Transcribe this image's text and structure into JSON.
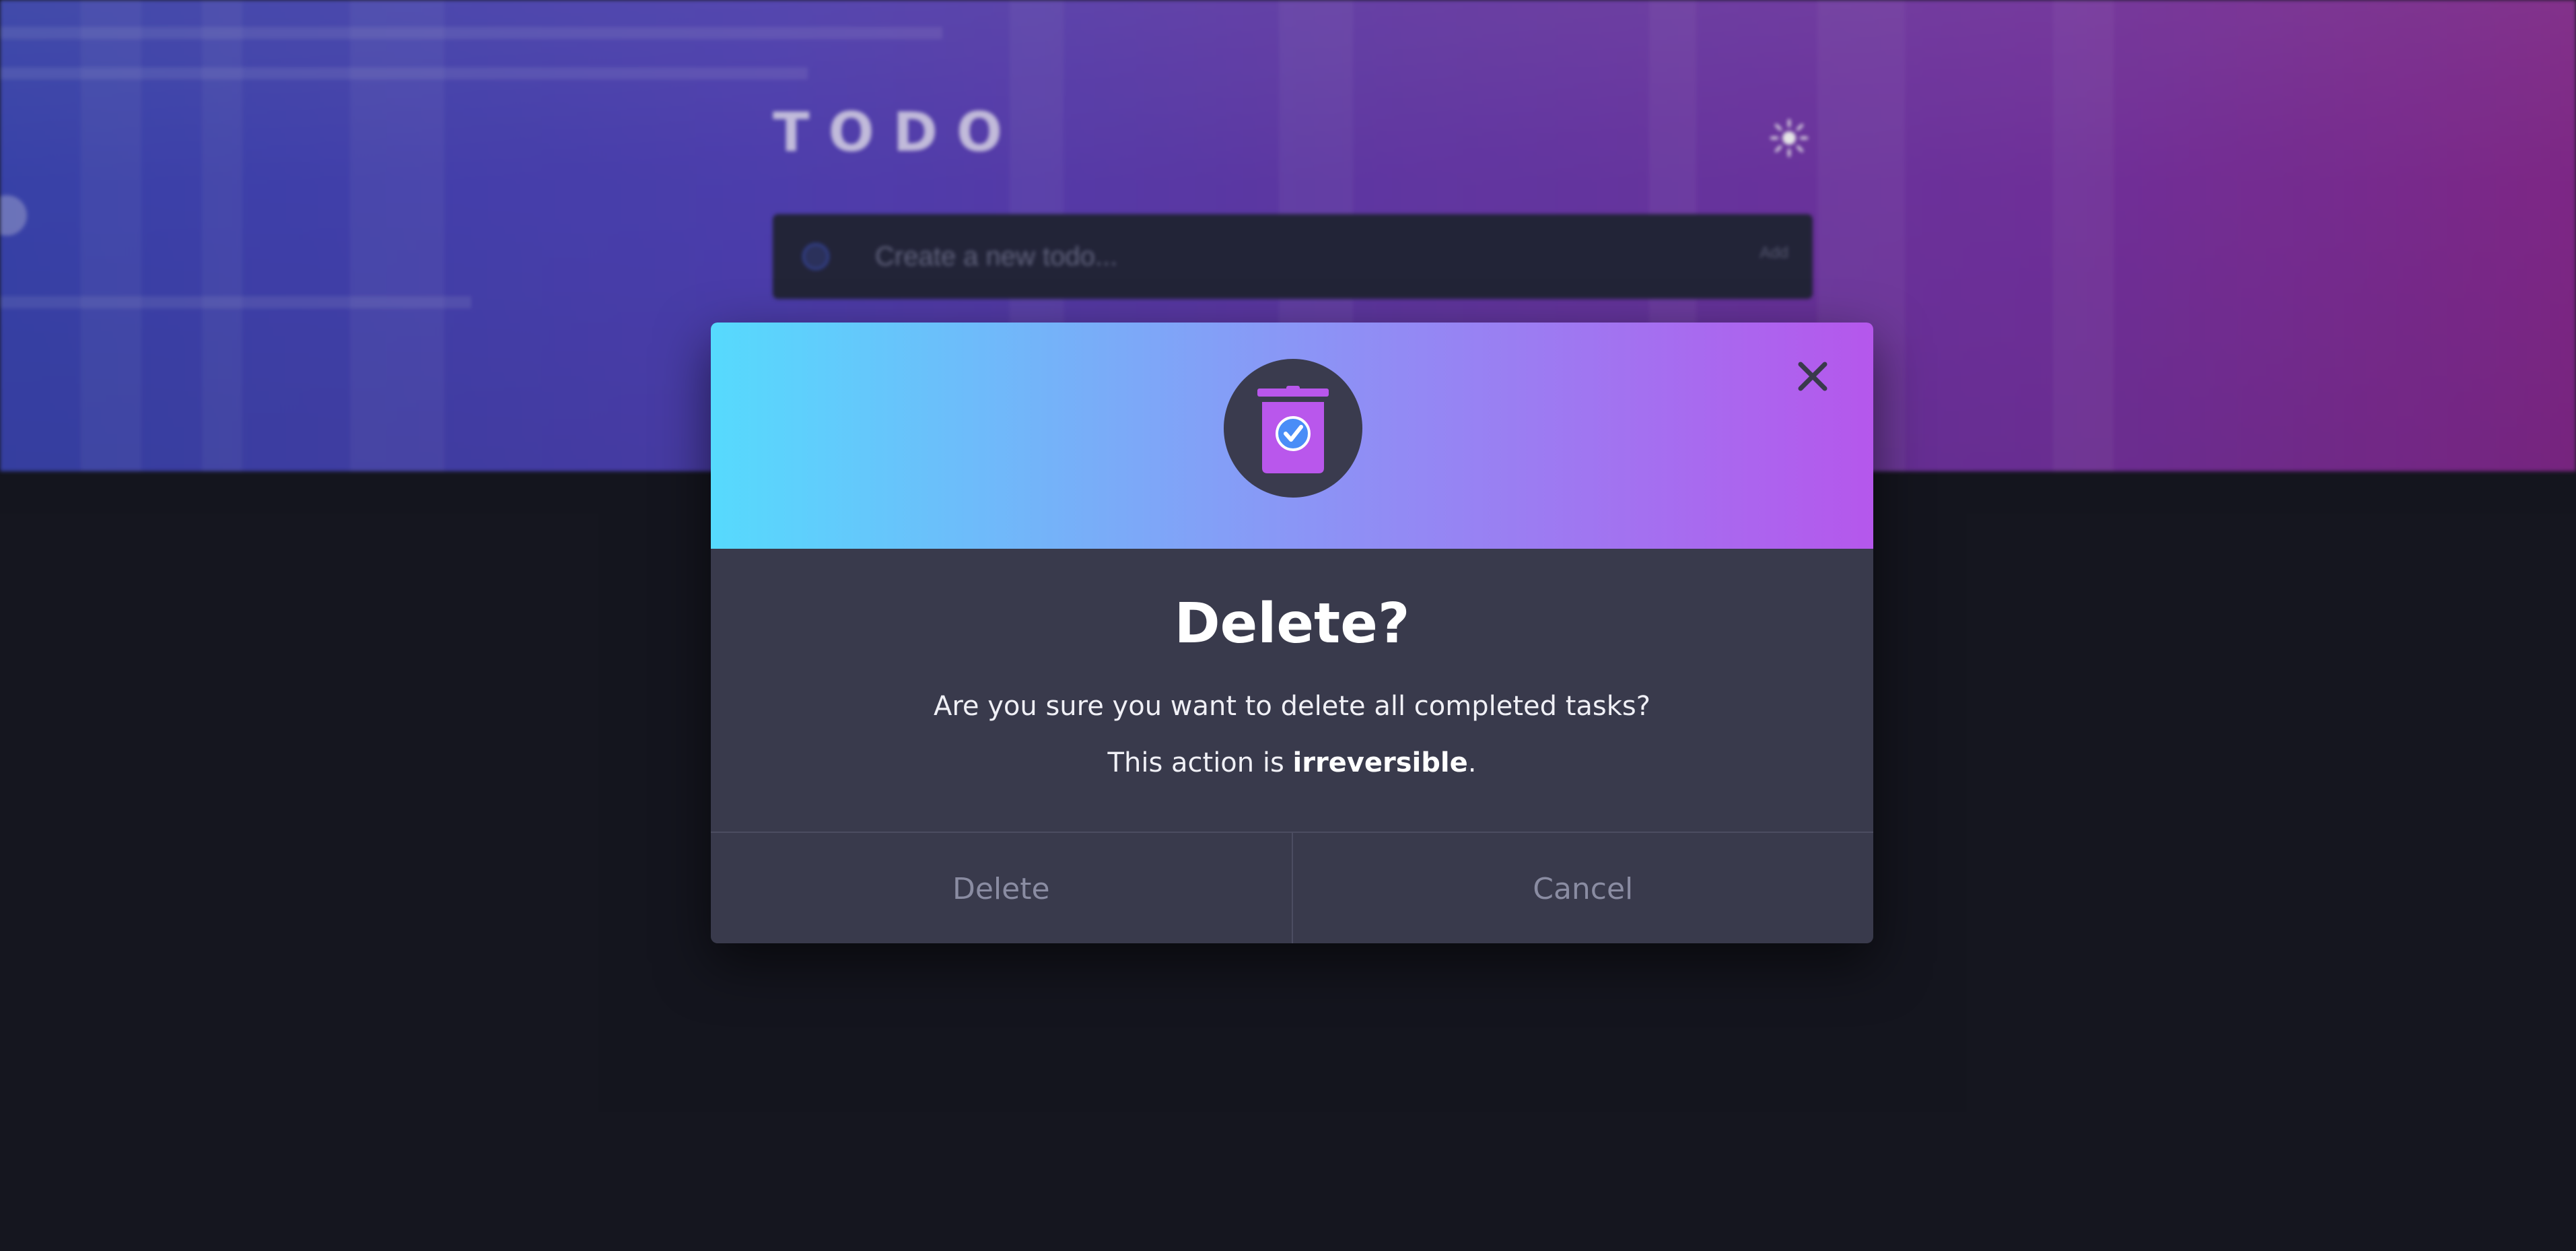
{
  "app": {
    "title": "TODO"
  },
  "theme_toggle": {
    "icon": "sun-icon"
  },
  "new_todo": {
    "placeholder": "Create a new todo...",
    "add_label": "Add"
  },
  "modal": {
    "icon": "trash-check-icon",
    "close_icon": "close-icon",
    "title": "Delete?",
    "message": "Are you sure you want to delete all completed tasks?",
    "warning_prefix": "This action is ",
    "warning_emphasis": "irreversible",
    "warning_suffix": ".",
    "delete_label": "Delete",
    "cancel_label": "Cancel"
  },
  "colors": {
    "background": "#161720",
    "hero_start": "#3d48b8",
    "hero_end": "#8a2a92",
    "modal_gradient_start": "#56dafd",
    "modal_gradient_end": "#b557ec",
    "modal_body": "#393a4c",
    "accent_purple": "#b557ec"
  }
}
